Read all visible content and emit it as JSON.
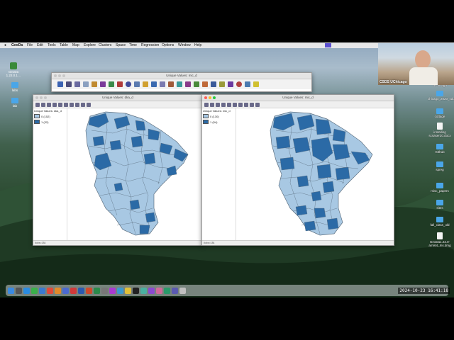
{
  "menubar": {
    "app": "GeoDa",
    "items": [
      "File",
      "Edit",
      "Tools",
      "Table",
      "Map",
      "Explore",
      "Clusters",
      "Space",
      "Time",
      "Regression",
      "Options",
      "Window",
      "Help"
    ]
  },
  "desktop_icons_left": [
    {
      "label": "GeoDa 1.22.0.1…",
      "icon": "app-icon"
    },
    {
      "label": "labs",
      "icon": "folder-icon"
    },
    {
      "label": "lab",
      "icon": "folder-icon"
    }
  ],
  "desktop_icons_right": [
    {
      "label": "UChicago",
      "icon": "folder-icon"
    },
    {
      "label": "chicago_2020_sdoh",
      "icon": "folder-icon"
    },
    {
      "label": "cottage",
      "icon": "folder-icon"
    },
    {
      "label": "installing scsaser20.docx",
      "icon": "document-icon"
    },
    {
      "label": "Github",
      "icon": "folder-icon"
    },
    {
      "label": "spreg",
      "icon": "folder-icon"
    },
    {
      "label": "misc_papers",
      "icon": "folder-icon"
    },
    {
      "label": "sites",
      "icon": "folder-icon"
    },
    {
      "label": "fall_class_old",
      "icon": "folder-icon"
    },
    {
      "label": "GeoDa1.22.0-arm64_Ins.dmg",
      "icon": "document-icon"
    }
  ],
  "toolbar_window": {
    "title": "Unique Values: mic_d"
  },
  "window_left": {
    "title": "Unique Values: dka_d",
    "legend_title": "Unique Values: dka_d",
    "legend": [
      {
        "label": "0 (152)",
        "color": "#a8c8e3"
      },
      {
        "label": "1 (32)",
        "color": "#2b6aa6"
      }
    ],
    "status": "#obs=184"
  },
  "window_right": {
    "title": "Unique Values: mic_d",
    "legend_title": "Unique Values: mic_d",
    "legend": [
      {
        "label": "0 (130)",
        "color": "#a8c8e3"
      },
      {
        "label": "1 (54)",
        "color": "#2b6aa6"
      }
    ],
    "status": "#obs=184"
  },
  "webcam": {
    "label": "CSDS UChicago"
  },
  "timestamp": "2024-10-23 16:41:18",
  "colors": {
    "light": "#a8c8e3",
    "dark": "#2b6aa6",
    "border": "#5c6f80"
  }
}
